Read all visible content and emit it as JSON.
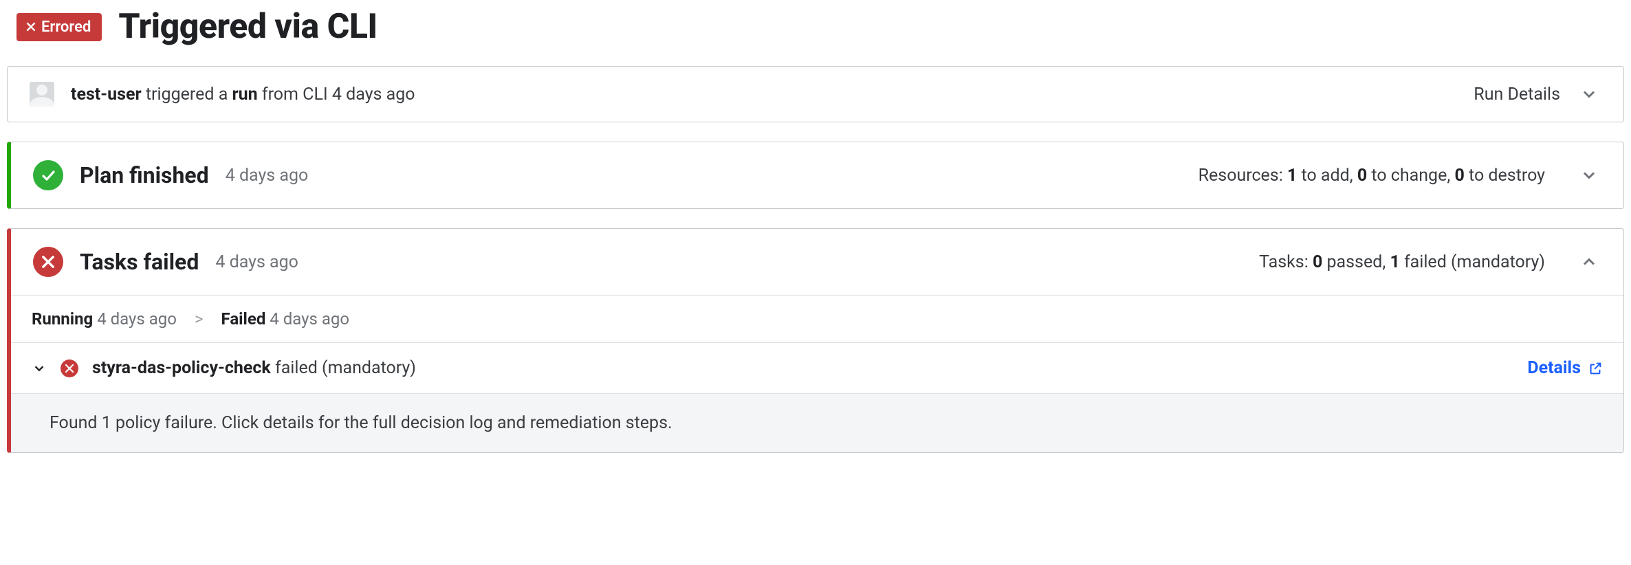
{
  "header": {
    "status_label": "Errored",
    "title": "Triggered via CLI"
  },
  "trigger": {
    "user": "test-user",
    "verb": "triggered a",
    "object": "run",
    "source": "from CLI",
    "when": "4 days ago",
    "details_label": "Run Details"
  },
  "plan": {
    "title": "Plan finished",
    "when": "4 days ago",
    "resources": {
      "prefix": "Resources:",
      "add": "1",
      "add_suffix": "to add,",
      "change": "0",
      "change_suffix": "to change,",
      "destroy": "0",
      "destroy_suffix": "to destroy"
    }
  },
  "tasks": {
    "title": "Tasks failed",
    "when": "4 days ago",
    "summary": {
      "prefix": "Tasks:",
      "passed": "0",
      "passed_suffix": "passed,",
      "failed": "1",
      "failed_suffix": "failed (mandatory)"
    },
    "stages": {
      "running_label": "Running",
      "running_when": "4 days ago",
      "failed_label": "Failed",
      "failed_when": "4 days ago"
    },
    "item": {
      "name": "styra-das-policy-check",
      "status_text": "failed (mandatory)",
      "details_label": "Details",
      "message": "Found 1 policy failure. Click details for the full decision log and remediation steps."
    }
  }
}
